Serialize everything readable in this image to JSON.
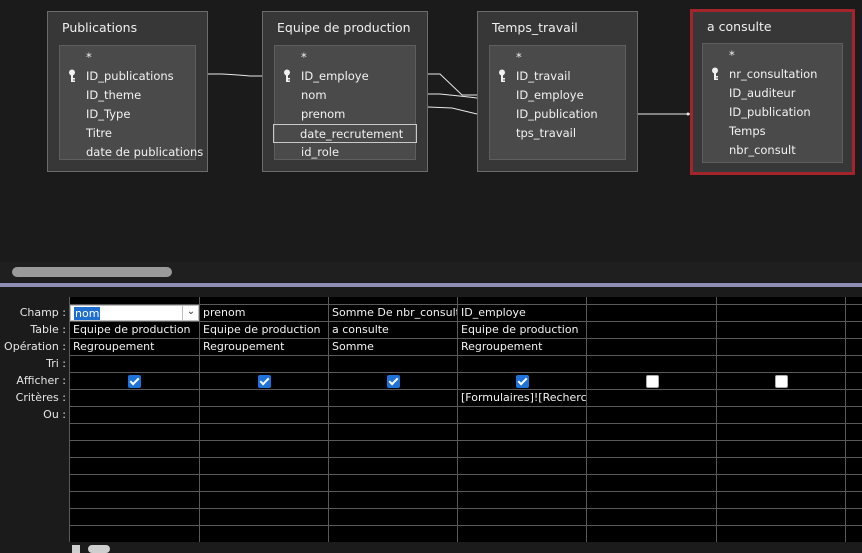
{
  "tables": [
    {
      "title": "Publications",
      "fields": [
        "*",
        "ID_publications",
        "ID_theme",
        "ID_Type",
        "Titre",
        "date de publications"
      ]
    },
    {
      "title": "Equipe de production",
      "fields": [
        "*",
        "ID_employe",
        "nom",
        "prenom",
        "date_recrutement",
        "id_role"
      ]
    },
    {
      "title": "Temps_travail",
      "fields": [
        "*",
        "ID_travail",
        "ID_employe",
        "ID_publication",
        "tps_travail"
      ]
    },
    {
      "title": "a consulte",
      "fields": [
        "*",
        "nr_consultation",
        "ID_auditeur",
        "ID_publication",
        "Temps",
        "nbr_consult"
      ]
    }
  ],
  "grid": {
    "row_labels": [
      "Champ :",
      "Table :",
      "Opération :",
      "Tri :",
      "Afficher :",
      "Critères :",
      "Ou :"
    ],
    "columns": [
      {
        "champ": "nom",
        "table": "Equipe de production",
        "operation": "Regroupement",
        "tri": "",
        "afficher": true,
        "criteres": "",
        "ou": ""
      },
      {
        "champ": "prenom",
        "table": "Equipe de production",
        "operation": "Regroupement",
        "tri": "",
        "afficher": true,
        "criteres": "",
        "ou": ""
      },
      {
        "champ": "Somme De nbr_consult: nbr_",
        "table": "a consulte",
        "operation": "Somme",
        "tri": "",
        "afficher": true,
        "criteres": "",
        "ou": ""
      },
      {
        "champ": "ID_employe",
        "table": "Equipe de production",
        "operation": "Regroupement",
        "tri": "",
        "afficher": true,
        "criteres": "[Formulaires]![Recherche",
        "ou": ""
      },
      {
        "champ": "",
        "table": "",
        "operation": "",
        "tri": "",
        "afficher": false,
        "criteres": "",
        "ou": ""
      },
      {
        "champ": "",
        "table": "",
        "operation": "",
        "tri": "",
        "afficher": false,
        "criteres": "",
        "ou": ""
      }
    ]
  },
  "colors": {
    "selected_border": "#a3242b",
    "check_on": "#1e72d8",
    "splitter": "#8f8fb6"
  }
}
